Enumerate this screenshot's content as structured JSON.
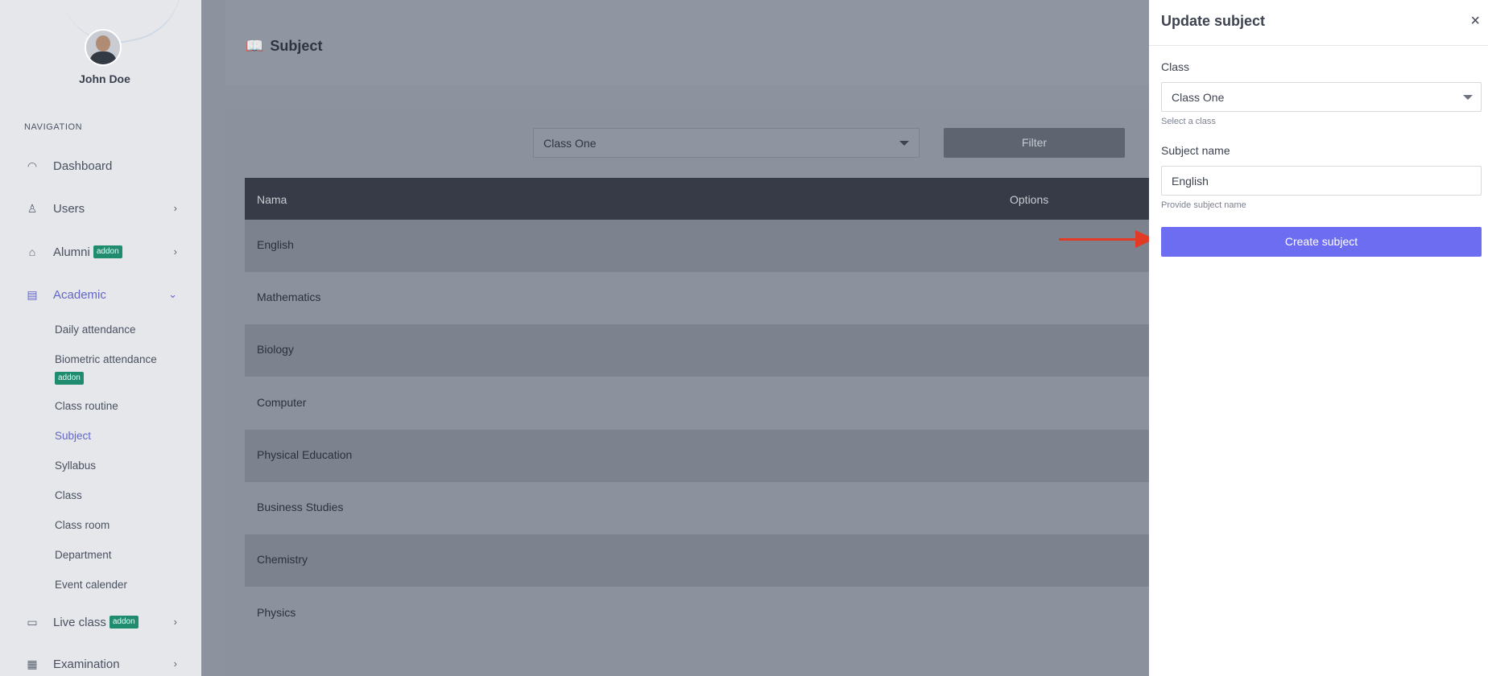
{
  "sidebar": {
    "user_name": "John Doe",
    "nav_title": "NAVIGATION",
    "items": [
      {
        "label": "Dashboard",
        "icon": "gauge-icon"
      },
      {
        "label": "Users",
        "icon": "user-icon"
      },
      {
        "label": "Alumni",
        "badge": "addon",
        "icon": "graduation-cap-icon"
      },
      {
        "label": "Academic",
        "icon": "building-icon"
      },
      {
        "label": "Live class",
        "badge": "addon",
        "icon": "video-icon"
      },
      {
        "label": "Examination",
        "icon": "clipboard-icon"
      }
    ],
    "academic_sub": [
      {
        "label": "Daily attendance"
      },
      {
        "label": "Biometric attendance",
        "badge": "addon"
      },
      {
        "label": "Class routine"
      },
      {
        "label": "Subject"
      },
      {
        "label": "Syllabus"
      },
      {
        "label": "Class"
      },
      {
        "label": "Class room"
      },
      {
        "label": "Department"
      },
      {
        "label": "Event calender"
      }
    ]
  },
  "page": {
    "title": "Subject",
    "filter_select": "Class One",
    "filter_button": "Filter",
    "table": {
      "headers": [
        "Nama",
        "Options"
      ],
      "rows": [
        "English",
        "Mathematics",
        "Biology",
        "Computer",
        "Physical Education",
        "Business Studies",
        "Chemistry",
        "Physics"
      ]
    }
  },
  "drawer": {
    "title": "Update subject",
    "close": "×",
    "class_label": "Class",
    "class_value": "Class One",
    "class_help": "Select a class",
    "subject_label": "Subject name",
    "subject_value": "English",
    "subject_help": "Provide subject name",
    "submit": "Create subject"
  },
  "colors": {
    "accent": "#6c6df0",
    "active_nav": "#6366c7",
    "badge": "#1f8b6f",
    "annotation_arrow": "#e23a24"
  }
}
